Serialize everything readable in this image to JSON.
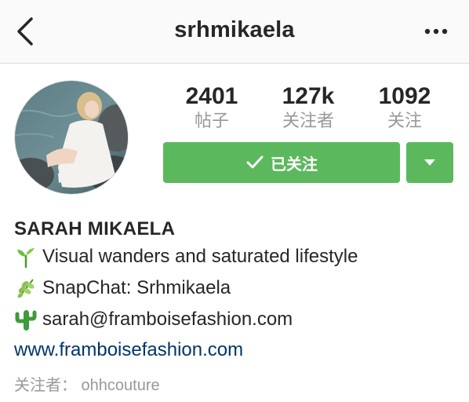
{
  "header": {
    "username": "srhmikaela"
  },
  "stats": [
    {
      "value": "2401",
      "label": "帖子"
    },
    {
      "value": "127k",
      "label": "关注者"
    },
    {
      "value": "1092",
      "label": "关注"
    }
  ],
  "actions": {
    "follow_label": "已关注"
  },
  "bio": {
    "name": "SARAH MIKAELA",
    "lines": [
      {
        "icon": "seedling-icon",
        "text": "Visual wanders and saturated lifestyle"
      },
      {
        "icon": "herb-icon",
        "text": "SnapChat: Srhmikaela"
      },
      {
        "icon": "cactus-icon",
        "text": "sarah@framboisefashion.com"
      }
    ],
    "website": "www.framboisefashion.com",
    "followed_by": "关注者： ohhcouture"
  },
  "colors": {
    "accent_green": "#5cb85c",
    "link_blue": "#003569",
    "muted_gray": "#999999"
  }
}
